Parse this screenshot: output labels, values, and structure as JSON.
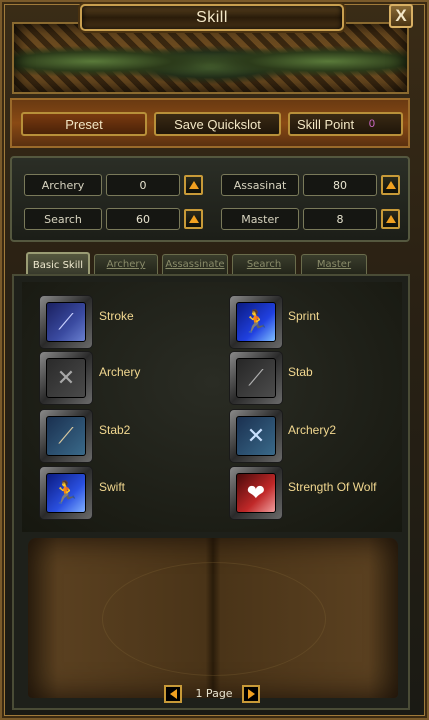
{
  "window": {
    "title": "Skill",
    "close_label": "X"
  },
  "toolbar": {
    "preset_label": "Preset",
    "save_quickslot_label": "Save Quickslot",
    "skill_point_label": "Skill Point",
    "skill_point_value": "0"
  },
  "stats": [
    {
      "label": "Archery",
      "value": "0"
    },
    {
      "label": "Assasinat",
      "value": "80"
    },
    {
      "label": "Search",
      "value": "60"
    },
    {
      "label": "Master",
      "value": "8"
    }
  ],
  "tabs": [
    {
      "label": "Basic Skill",
      "active": true
    },
    {
      "label": "Archery",
      "active": false
    },
    {
      "label": "Assassinate",
      "active": false
    },
    {
      "label": "Search",
      "active": false
    },
    {
      "label": "Master",
      "active": false
    }
  ],
  "skills": [
    {
      "name": "Stroke",
      "icon": "stroke-icon"
    },
    {
      "name": "Sprint",
      "icon": "sprint-icon"
    },
    {
      "name": "Archery",
      "icon": "archery-icon"
    },
    {
      "name": "Stab",
      "icon": "stab-icon"
    },
    {
      "name": "Stab2",
      "icon": "stab2-icon"
    },
    {
      "name": "Archery2",
      "icon": "archery2-icon"
    },
    {
      "name": "Swift",
      "icon": "swift-icon"
    },
    {
      "name": "Strength Of Wolf",
      "icon": "strength-of-wolf-icon"
    }
  ],
  "pager": {
    "label": "1 Page"
  }
}
